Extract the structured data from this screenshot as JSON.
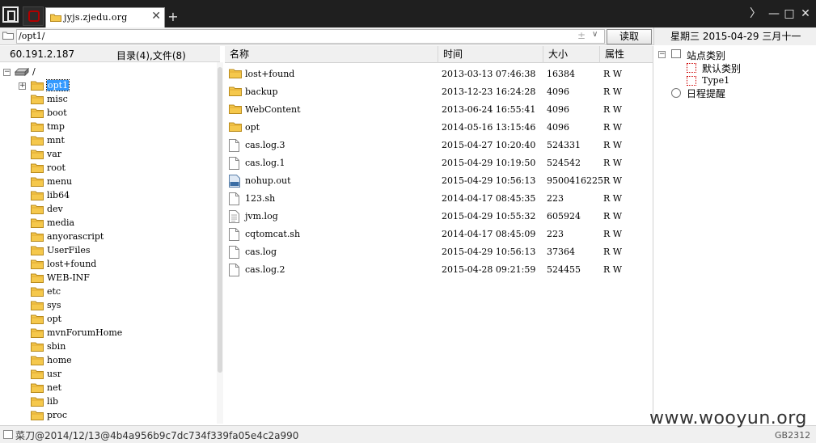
{
  "tabs": {
    "active_title": "jyjs.zjedu.org"
  },
  "window": {
    "new_tab": "+",
    "chevron": "〉",
    "min": "—",
    "max": "□",
    "close": "✕",
    "tab_close": "✕"
  },
  "pathbar": {
    "path": "/opt1/",
    "plusminus": "±",
    "dropdown": "∨",
    "read_label": "读取"
  },
  "datebar": {
    "text": "星期三  2015-04-29  三月十一"
  },
  "infobar": {
    "ip": "60.191.2.187",
    "count": "目录(4),文件(8)"
  },
  "tree": {
    "root_label": "/",
    "items": [
      {
        "label": "opt1",
        "selected": true,
        "expander": "+"
      },
      {
        "label": "misc"
      },
      {
        "label": "boot"
      },
      {
        "label": "tmp"
      },
      {
        "label": "mnt"
      },
      {
        "label": "var"
      },
      {
        "label": "root"
      },
      {
        "label": "menu"
      },
      {
        "label": "lib64"
      },
      {
        "label": "dev"
      },
      {
        "label": "media"
      },
      {
        "label": "anyorascript"
      },
      {
        "label": "UserFiles"
      },
      {
        "label": "lost+found"
      },
      {
        "label": "WEB-INF"
      },
      {
        "label": "etc"
      },
      {
        "label": "sys"
      },
      {
        "label": "opt"
      },
      {
        "label": "mvnForumHome"
      },
      {
        "label": "sbin"
      },
      {
        "label": "home"
      },
      {
        "label": "usr"
      },
      {
        "label": "net"
      },
      {
        "label": "lib"
      },
      {
        "label": "proc"
      }
    ]
  },
  "filelist": {
    "headers": {
      "name": "名称",
      "time": "时间",
      "size": "大小",
      "attr": "属性"
    },
    "rows": [
      {
        "name": "lost+found",
        "time": "2013-03-13 07:46:38",
        "size": "16384",
        "attr": "R W",
        "kind": "folder"
      },
      {
        "name": "backup",
        "time": "2013-12-23 16:24:28",
        "size": "4096",
        "attr": "R W",
        "kind": "folder"
      },
      {
        "name": "WebContent",
        "time": "2013-06-24 16:55:41",
        "size": "4096",
        "attr": "R W",
        "kind": "folder"
      },
      {
        "name": "opt",
        "time": "2014-05-16 13:15:46",
        "size": "4096",
        "attr": "R W",
        "kind": "folder"
      },
      {
        "name": "cas.log.3",
        "time": "2015-04-27 10:20:40",
        "size": "524331",
        "attr": "R W",
        "kind": "file"
      },
      {
        "name": "cas.log.1",
        "time": "2015-04-29 10:19:50",
        "size": "524542",
        "attr": "R W",
        "kind": "file"
      },
      {
        "name": "nohup.out",
        "time": "2015-04-29 10:56:13",
        "size": "9500416225",
        "attr": "R W",
        "kind": "binary"
      },
      {
        "name": "123.sh",
        "time": "2014-04-17 08:45:35",
        "size": "223",
        "attr": "R W",
        "kind": "file"
      },
      {
        "name": "jvm.log",
        "time": "2015-04-29 10:55:32",
        "size": "605924",
        "attr": "R W",
        "kind": "text"
      },
      {
        "name": "cqtomcat.sh",
        "time": "2014-04-17 08:45:09",
        "size": "223",
        "attr": "R W",
        "kind": "file"
      },
      {
        "name": "cas.log",
        "time": "2015-04-29 10:56:13",
        "size": "37364",
        "attr": "R W",
        "kind": "file"
      },
      {
        "name": "cas.log.2",
        "time": "2015-04-28 09:21:59",
        "size": "524455",
        "attr": "R W",
        "kind": "file"
      }
    ]
  },
  "rightpanel": {
    "site_category": "站点类别",
    "default_category": "默认类别",
    "type1": "Type1",
    "schedule": "日程提醒",
    "collapse_sign": "−"
  },
  "statusbar": {
    "text": "菜刀@2014/12/13@4b4a956b9c7dc734f339fa05e4c2a990",
    "encoding": "GB2312",
    "watermark": "www.wooyun.org"
  },
  "colors": {
    "titlebar": "#1f1f1f",
    "selection": "#3399ff",
    "folder": "#f5c84c"
  }
}
